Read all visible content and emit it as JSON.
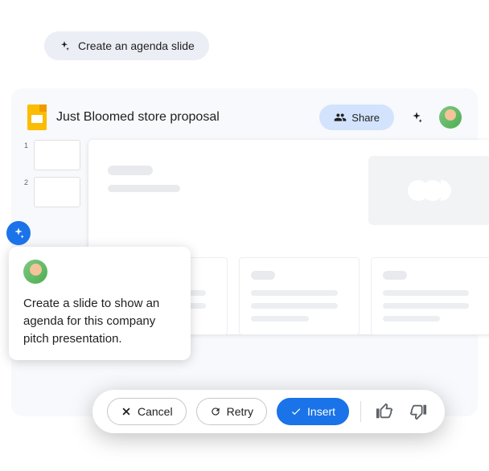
{
  "agenda_pill": {
    "label": "Create an agenda slide"
  },
  "app": {
    "title": "Just Bloomed store proposal",
    "share_label": "Share"
  },
  "thumbnails": [
    {
      "number": "1"
    },
    {
      "number": "2"
    }
  ],
  "prompt": {
    "text": "Create a slide to show an agenda for this company pitch presentation."
  },
  "actions": {
    "cancel": "Cancel",
    "retry": "Retry",
    "insert": "Insert"
  }
}
